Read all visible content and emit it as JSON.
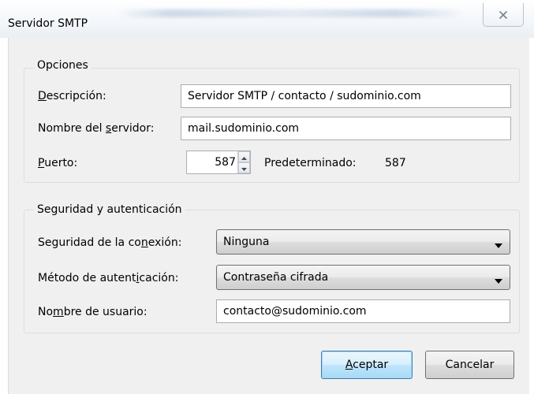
{
  "window": {
    "title": "Servidor SMTP",
    "close_icon": "close-icon"
  },
  "options": {
    "legend": "Opciones",
    "description": {
      "label_pre": "",
      "label_accel": "D",
      "label_post": "escripción:",
      "value": "Servidor SMTP / contacto / sudominio.com"
    },
    "server": {
      "label_pre": "Nombre del ",
      "label_accel": "s",
      "label_post": "ervidor:",
      "value": "mail.sudominio.com"
    },
    "port": {
      "label_pre": "",
      "label_accel": "P",
      "label_post": "uerto:",
      "value": "587",
      "default_label": "Predeterminado:",
      "default_value": "587"
    }
  },
  "security": {
    "legend": "Seguridad y autenticación",
    "connection_security": {
      "label_pre": "Seguridad de la co",
      "label_accel": "n",
      "label_post": "exión:",
      "selected": "Ninguna"
    },
    "auth_method": {
      "label_pre": "Método de autent",
      "label_accel": "i",
      "label_post": "cación:",
      "selected": "Contraseña cifrada"
    },
    "username": {
      "label_pre": "No",
      "label_accel": "m",
      "label_post": "bre de usuario:",
      "value": "contacto@sudominio.com"
    }
  },
  "buttons": {
    "accept": {
      "label_pre": "",
      "label_accel": "A",
      "label_post": "ceptar"
    },
    "cancel": {
      "label": "Cancelar"
    }
  },
  "colors": {
    "client_bg": "#f0f0f0",
    "default_button": "#3c7fb1"
  }
}
